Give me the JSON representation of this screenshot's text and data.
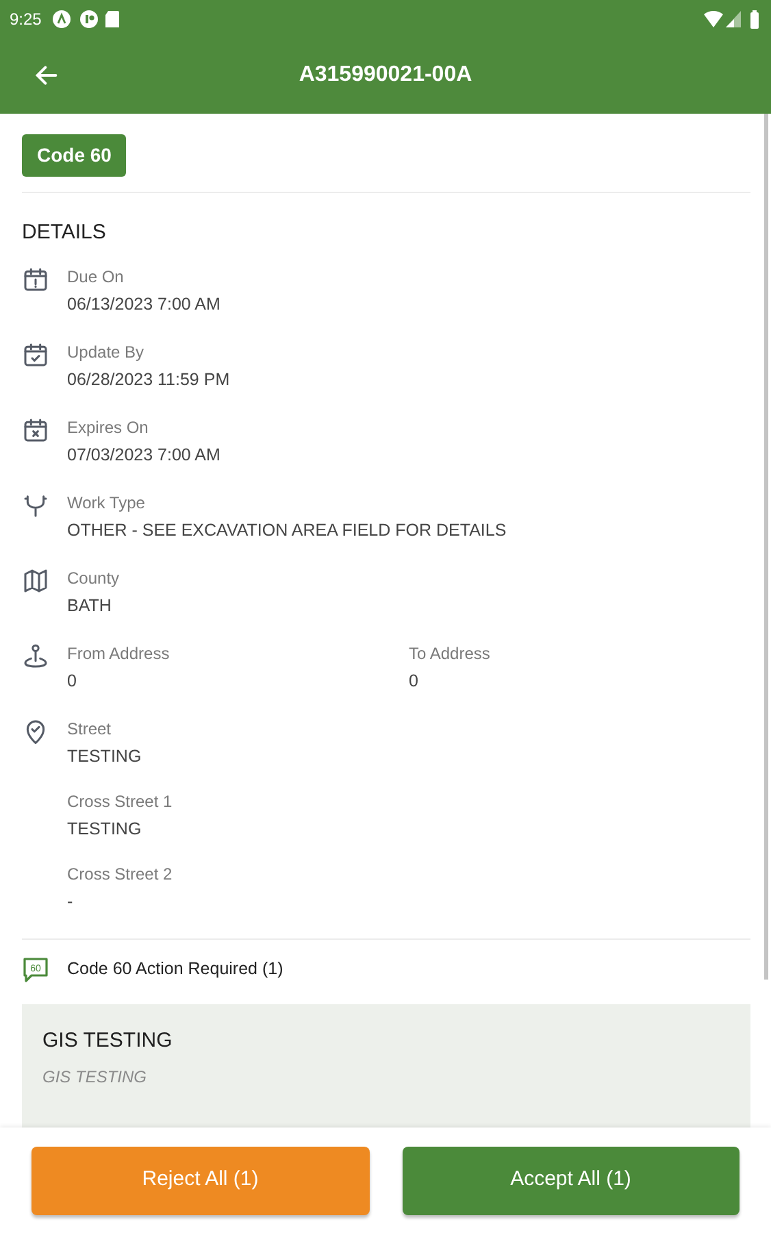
{
  "status_bar": {
    "time": "9:25"
  },
  "app_bar": {
    "title": "A315990021-00A"
  },
  "badge": "Code 60",
  "details": {
    "heading": "DETAILS",
    "groups": [
      {
        "kind": "due",
        "fields": [
          {
            "label": "Due On",
            "value": "06/13/2023 7:00 AM"
          }
        ]
      },
      {
        "kind": "update",
        "fields": [
          {
            "label": "Update By",
            "value": "06/28/2023 11:59 PM"
          }
        ]
      },
      {
        "kind": "expires",
        "fields": [
          {
            "label": "Expires On",
            "value": "07/03/2023 7:00 AM"
          }
        ]
      },
      {
        "kind": "worktype",
        "fields": [
          {
            "label": "Work Type",
            "value": "OTHER - SEE EXCAVATION AREA FIELD FOR DETAILS"
          }
        ]
      },
      {
        "kind": "county",
        "fields": [
          {
            "label": "County",
            "value": "BATH"
          }
        ]
      },
      {
        "kind": "address",
        "fields": [
          {
            "label": "From Address",
            "value": "0"
          },
          {
            "label": "To Address",
            "value": "0"
          }
        ]
      },
      {
        "kind": "street",
        "fields": [
          {
            "label": "Street",
            "value": "TESTING"
          },
          {
            "label": "Cross Street 1",
            "value": "TESTING"
          },
          {
            "label": "Cross Street 2",
            "value": "-"
          }
        ]
      }
    ]
  },
  "action_required": {
    "text": "Code 60 Action Required (1)",
    "icon_text": "60"
  },
  "member_card": {
    "title": "GIS TESTING",
    "subtitle": "GIS TESTING"
  },
  "buttons": [
    {
      "kind": "reject",
      "label": "Reject All (1)"
    },
    {
      "kind": "accept",
      "label": "Accept All (1)"
    }
  ]
}
